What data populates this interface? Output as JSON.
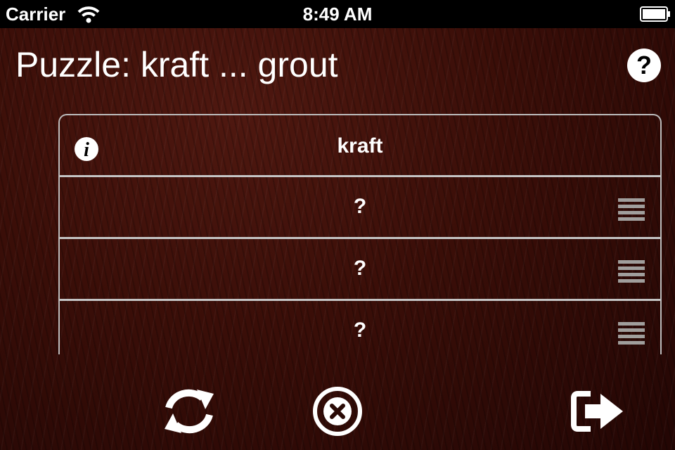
{
  "status_bar": {
    "carrier": "Carrier",
    "time": "8:49 AM",
    "wifi_icon": "wifi-icon",
    "battery_icon": "battery-icon"
  },
  "header": {
    "title": "Puzzle: kraft ... grout",
    "help_icon": "question-circle-icon"
  },
  "word_list": {
    "rows": [
      {
        "text": "kraft",
        "icon": "info-icon"
      },
      {
        "text": "?",
        "icon": "reorder-handle-icon"
      },
      {
        "text": "?",
        "icon": "reorder-handle-icon"
      },
      {
        "text": "?",
        "icon": "reorder-handle-icon"
      }
    ]
  },
  "toolbar": {
    "refresh_icon": "refresh-icon",
    "clear_icon": "clear-circle-icon",
    "exit_icon": "exit-icon"
  },
  "colors": {
    "text": "#ffffff",
    "row_divider": "#c4c4c4",
    "handle": "#a09e9c",
    "background": "#3a0e08"
  }
}
